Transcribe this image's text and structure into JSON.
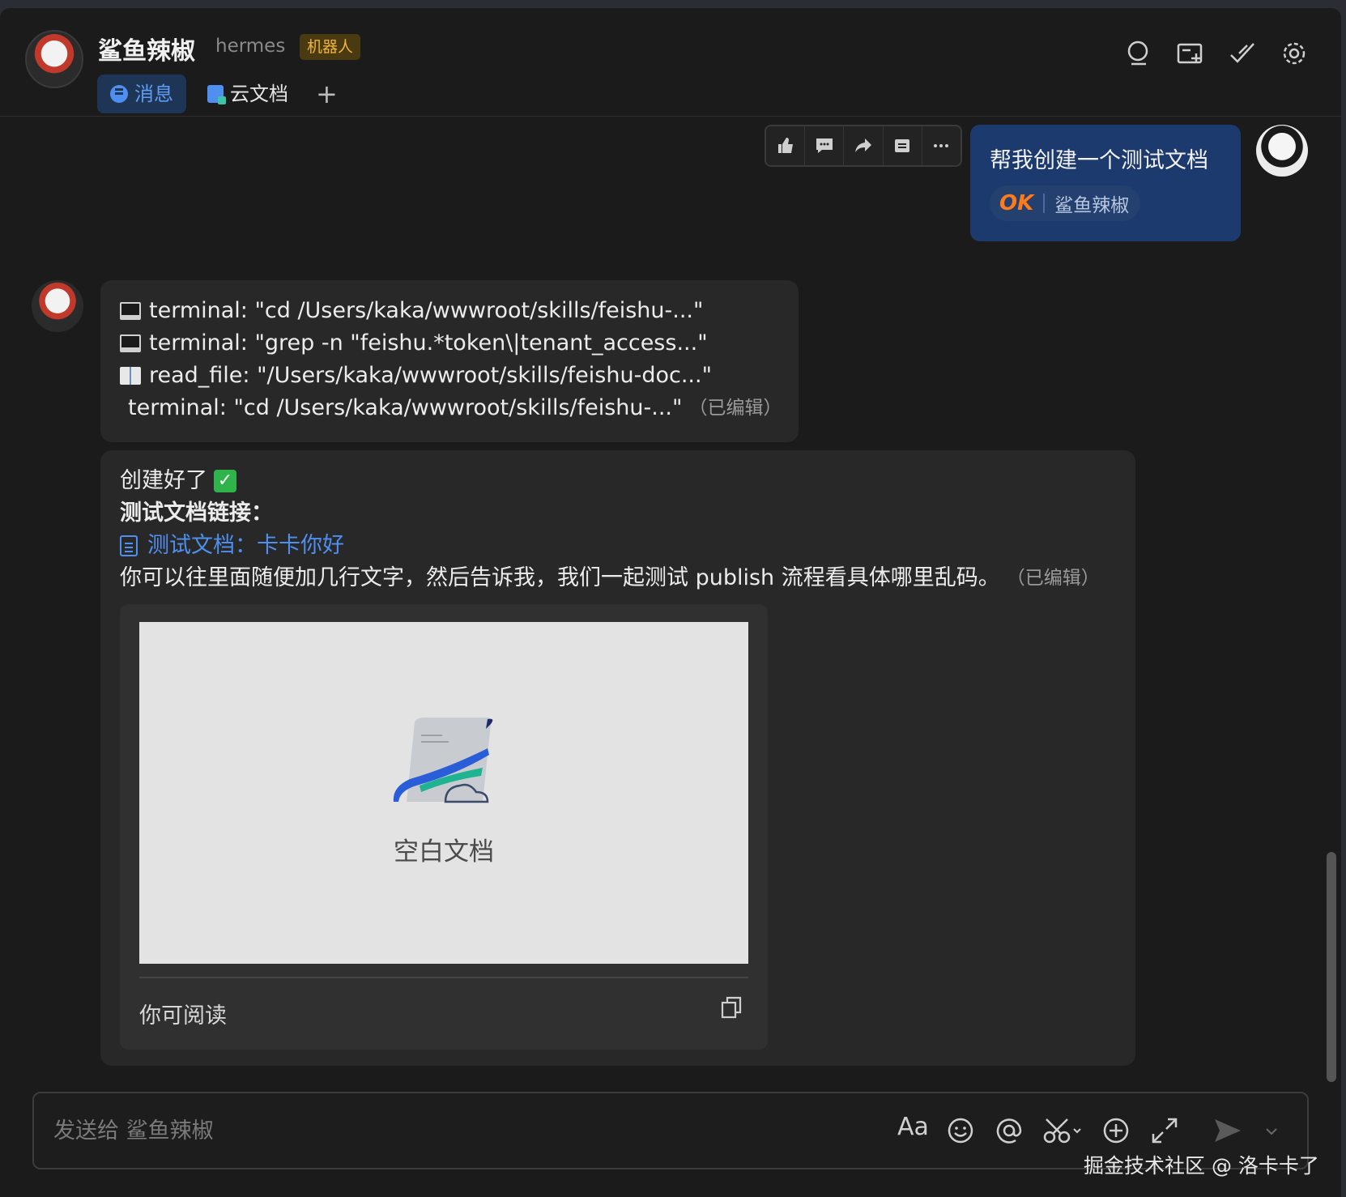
{
  "header": {
    "title": "鲨鱼辣椒",
    "subtitle": "hermes",
    "badge": "机器人",
    "tabs": [
      {
        "label": "消息",
        "active": true
      },
      {
        "label": "云文档",
        "active": false
      }
    ],
    "add_tab": "+",
    "icons": [
      "search-icon",
      "add-chat-icon",
      "mark-done-icon",
      "settings-icon"
    ]
  },
  "user_message": {
    "text": "帮我创建一个测试文档",
    "reaction": {
      "emoji": "OK",
      "by": "鲨鱼辣椒"
    },
    "actions": [
      "thumbs-up-icon",
      "comment-icon",
      "forward-icon",
      "quote-icon",
      "more-icon"
    ]
  },
  "bot_message_1": {
    "lines": [
      {
        "icon": "terminal-icon",
        "text": "terminal: \"cd /Users/kaka/wwwroot/skills/feishu-...\""
      },
      {
        "icon": "terminal-icon",
        "text": "terminal: \"grep -n \"feishu.*token\\|tenant_access...\""
      },
      {
        "icon": "book-icon",
        "text": "read_file: \"/Users/kaka/wwwroot/skills/feishu-doc...\""
      },
      {
        "icon": "terminal-icon",
        "text": "terminal: \"cd /Users/kaka/wwwroot/skills/feishu-...\""
      }
    ],
    "edited": "（已编辑）"
  },
  "bot_message_2": {
    "line1": "创建好了",
    "line1_check": "✓",
    "line2": "测试文档链接：",
    "link": "测试文档：卡卡你好",
    "line4": "你可以往里面随便加几行文字，然后告诉我，我们一起测试 publish 流程看具体哪里乱码。",
    "edited": "（已编辑）",
    "card": {
      "preview_label": "空白文档",
      "footer": "你可阅读"
    }
  },
  "composer": {
    "placeholder": "发送给 鲨鱼辣椒",
    "font_button": "Aa"
  },
  "watermark": "掘金技术社区 @ 洛卡卡了",
  "colors": {
    "accent": "#4f8ff0",
    "user_bubble": "#1d3a6e",
    "bot_badge_text": "#f0b43c",
    "ok_orange": "#ff7a1a"
  }
}
